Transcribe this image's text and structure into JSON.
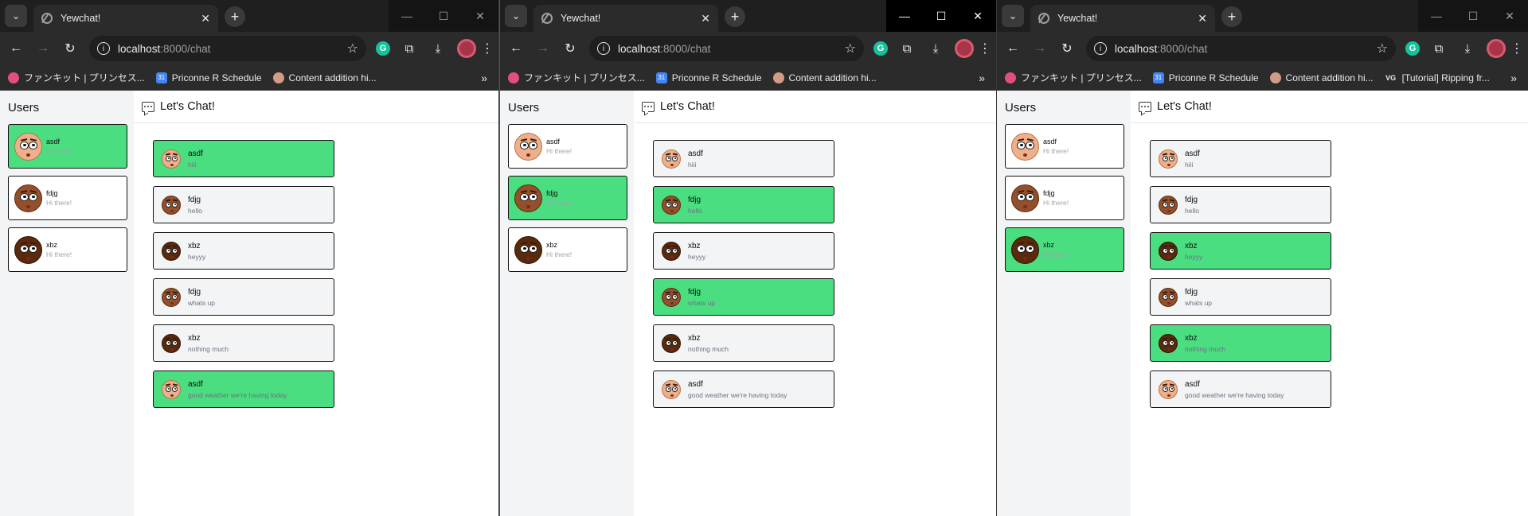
{
  "windows": [
    {
      "tab_title": "Yewchat!",
      "url_host": "localhost",
      "url_rest": ":8000/chat",
      "bookmarks": [
        "ファンキット | プリンセス...",
        "Priconne R Schedule",
        "Content addition hi..."
      ],
      "active_user": "asdf"
    },
    {
      "tab_title": "Yewchat!",
      "url_host": "localhost",
      "url_rest": ":8000/chat",
      "bookmarks": [
        "ファンキット | プリンセス...",
        "Priconne R Schedule",
        "Content addition hi..."
      ],
      "active_user": "fdjg"
    },
    {
      "tab_title": "Yewchat!",
      "url_host": "localhost",
      "url_rest": ":8000/chat",
      "bookmarks": [
        "ファンキット | プリンセス...",
        "Priconne R Schedule",
        "Content addition hi...",
        "[Tutorial] Ripping fr..."
      ],
      "active_user": "xbz"
    }
  ],
  "sidebar_title": "Users",
  "chat_title": "Let's Chat!",
  "users": [
    {
      "name": "asdf",
      "status": "Hi there!",
      "avatar": "asdf"
    },
    {
      "name": "fdjg",
      "status": "Hi there!",
      "avatar": "fdjg"
    },
    {
      "name": "xbz",
      "status": "Hi there!",
      "avatar": "xbz"
    }
  ],
  "messages": [
    {
      "from": "asdf",
      "text": "hiii"
    },
    {
      "from": "fdjg",
      "text": "hello"
    },
    {
      "from": "xbz",
      "text": "heyyy"
    },
    {
      "from": "fdjg",
      "text": "whats up"
    },
    {
      "from": "xbz",
      "text": "nothing much"
    },
    {
      "from": "asdf",
      "text": "good weather we're having today"
    }
  ],
  "icons": {
    "tab_favicon": "globe-icon",
    "back": "arrow-left-icon",
    "forward": "arrow-right-icon",
    "reload": "reload-icon",
    "site_info": "info-icon",
    "bookmark_star": "star-icon",
    "chat": "chat-bubble-icon"
  },
  "colors": {
    "active_green": "#4ade80",
    "sidebar_bg": "#f3f4f6",
    "chrome_dark": "#2b2b2b"
  }
}
